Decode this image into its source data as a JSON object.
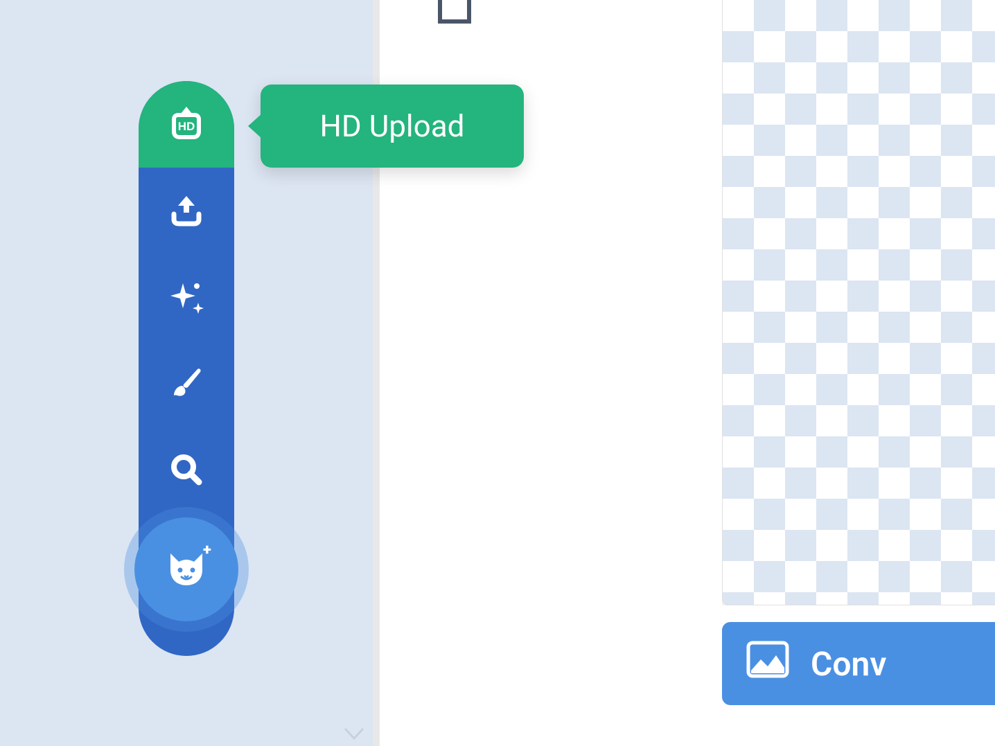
{
  "tooltip": {
    "label": "HD Upload"
  },
  "toolbar": {
    "items": [
      {
        "name": "hd-upload",
        "icon": "hd-upload-icon"
      },
      {
        "name": "upload",
        "icon": "upload-icon"
      },
      {
        "name": "effects",
        "icon": "sparkle-icon"
      },
      {
        "name": "brush",
        "icon": "brush-icon"
      },
      {
        "name": "search",
        "icon": "search-icon"
      },
      {
        "name": "cat",
        "icon": "cat-icon"
      }
    ]
  },
  "convert_button": {
    "label": "Conv"
  },
  "colors": {
    "toolbar_bg": "#3167c4",
    "active_green": "#24b47e",
    "accent_blue": "#4a90e2",
    "panel_bg": "#dce5f2"
  }
}
